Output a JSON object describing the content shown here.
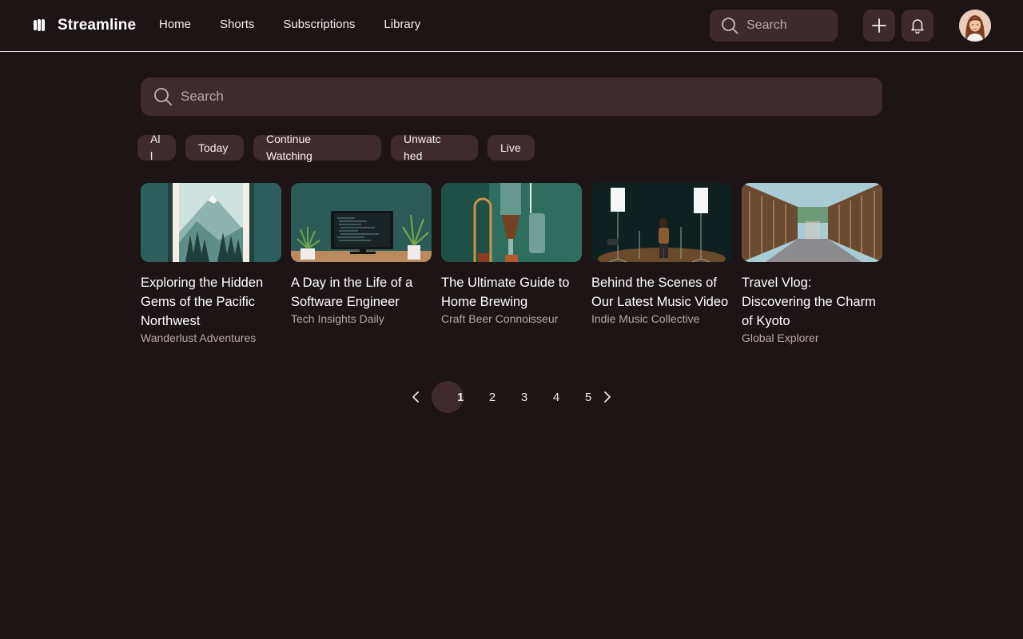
{
  "app": {
    "name": "Streamline"
  },
  "nav": {
    "items": [
      "Home",
      "Shorts",
      "Subscriptions",
      "Library"
    ]
  },
  "header": {
    "search_placeholder": "Search",
    "create_icon": "plus-icon",
    "notifications_icon": "bell-icon"
  },
  "main_search": {
    "placeholder": "Search"
  },
  "filters": {
    "chips": [
      "All",
      "Today",
      "Continue Watching",
      "Unwatched",
      "Live"
    ]
  },
  "videos": [
    {
      "title": "Exploring the Hidden Gems of the Pacific Northwest",
      "channel": "Wanderlust Adventures"
    },
    {
      "title": "A Day in the Life of a Software Engineer",
      "channel": "Tech Insights Daily"
    },
    {
      "title": "The Ultimate Guide to Home Brewing",
      "channel": "Craft Beer Connoisseur"
    },
    {
      "title": "Behind the Scenes of Our Latest Music Video",
      "channel": "Indie Music Collective"
    },
    {
      "title": "Travel Vlog: Discovering the Charm of Kyoto",
      "channel": "Global Explorer"
    }
  ],
  "pagination": {
    "pages": [
      "1",
      "2",
      "3",
      "4",
      "5"
    ],
    "current": "1",
    "prev_icon": "chevron-left-icon",
    "next_icon": "chevron-right-icon"
  },
  "colors": {
    "background": "#1d1415",
    "surface": "#3f2a2d",
    "text_secondary": "#b6a7a9"
  }
}
